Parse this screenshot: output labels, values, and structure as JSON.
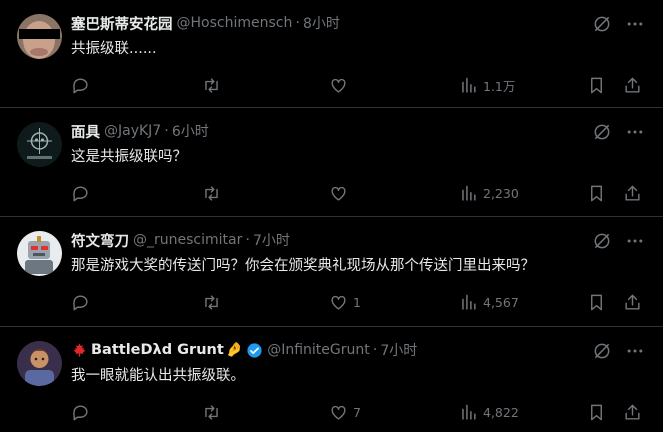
{
  "tweets": [
    {
      "display_name": "塞巴斯蒂安花园",
      "handle": "@Hoschimensch",
      "time": "8小时",
      "text": "共振级联......",
      "replies": "",
      "retweets": "",
      "likes": "",
      "views": "1.1万",
      "avatar_icon": "face-censored-avatar"
    },
    {
      "display_name": "面具",
      "handle": "@JayKJ7",
      "time": "6小时",
      "text": "这是共振级联吗？",
      "replies": "",
      "retweets": "",
      "likes": "",
      "views": "2,230",
      "avatar_icon": "skull-emblem-avatar"
    },
    {
      "display_name": "符文弯刀",
      "handle": "@_runescimitar",
      "time": "7小时",
      "text": "那是游戏大奖的传送门吗？你会在颁奖典礼现场从那个传送门里出来吗？",
      "replies": "",
      "retweets": "",
      "likes": "1",
      "views": "4,567",
      "avatar_icon": "robot-avatar"
    },
    {
      "display_name": "BattleDλd Grunt",
      "display_name_suffix": "🤌",
      "handle": "@InfiniteGrunt",
      "time": "7小时",
      "text": "我一眼就能认出共振级联。",
      "replies": "",
      "retweets": "",
      "likes": "7",
      "views": "4,822",
      "avatar_icon": "character-avatar"
    }
  ],
  "separator": "·",
  "colors": {
    "background": "#000000",
    "text_primary": "#e7e9ea",
    "text_secondary": "#71767b",
    "divider": "#2f3336",
    "verified": "#1d9bf0",
    "flag_red": "#e0272b"
  }
}
